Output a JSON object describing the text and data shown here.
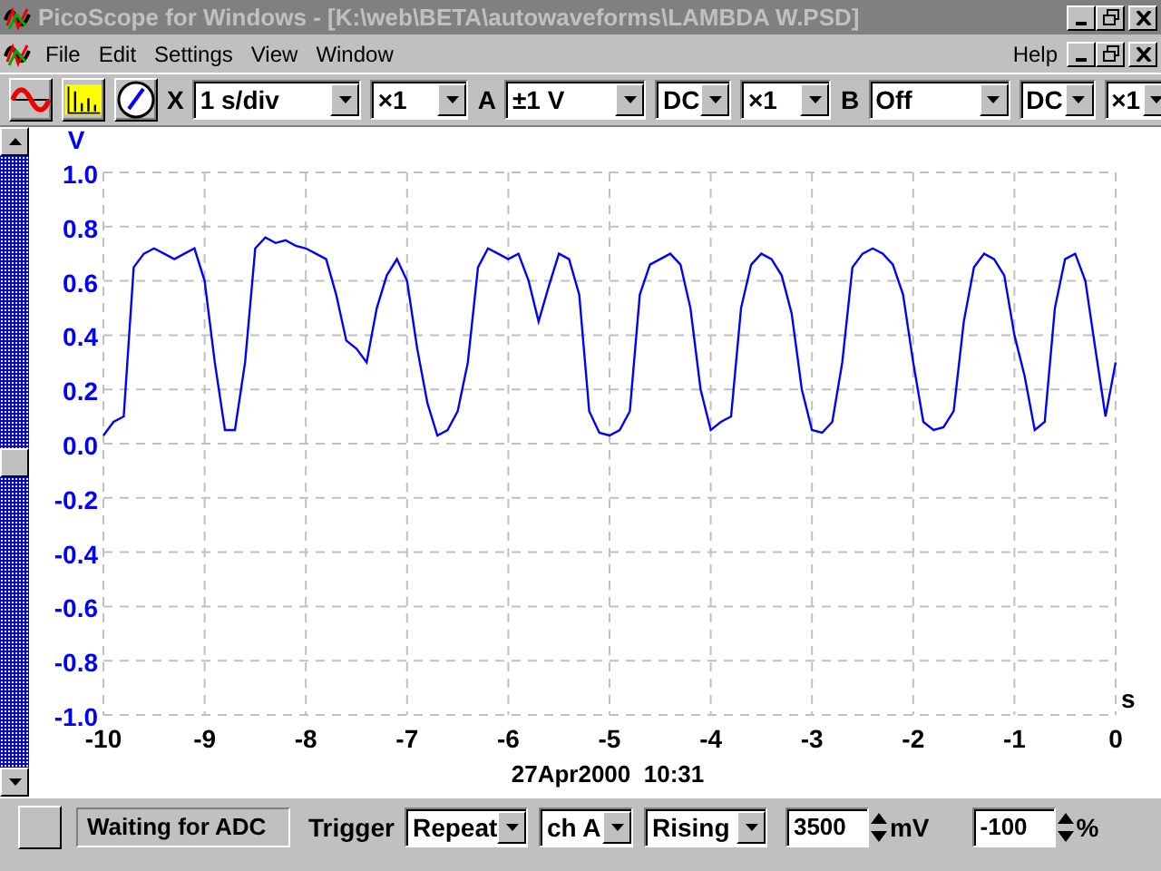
{
  "window": {
    "title": "PicoScope for Windows - [K:\\web\\BETA\\autowaveforms\\LAMBDA W.PSD]"
  },
  "menu": {
    "items": [
      "File",
      "Edit",
      "Settings",
      "View",
      "Window"
    ],
    "help": "Help"
  },
  "toolbar": [
    {
      "kind": "label",
      "text": "X"
    },
    {
      "kind": "dropdown",
      "value": "1 s/div"
    },
    {
      "kind": "dropdown",
      "value": "×1"
    },
    {
      "kind": "label",
      "text": "A"
    },
    {
      "kind": "dropdown",
      "value": "±1 V"
    },
    {
      "kind": "dropdown",
      "value": "DC"
    },
    {
      "kind": "dropdown",
      "value": "×1"
    },
    {
      "kind": "label",
      "text": "B"
    },
    {
      "kind": "dropdown",
      "value": "Off"
    },
    {
      "kind": "dropdown",
      "value": "DC"
    },
    {
      "kind": "dropdown",
      "value": "×1"
    }
  ],
  "plot": {
    "y_unit": "V",
    "x_unit": "s",
    "timestamp": "27Apr2000  10:31",
    "chart_data": {
      "type": "line",
      "grid": true,
      "xlim": [
        -10,
        0
      ],
      "ylim": [
        -1,
        1
      ],
      "xticks": [
        -10,
        -9,
        -8,
        -7,
        -6,
        -5,
        -4,
        -3,
        -2,
        -1,
        0
      ],
      "yticks": [
        {
          "value": 1,
          "label": "1.0"
        },
        {
          "value": 0.8,
          "label": "0.8"
        },
        {
          "value": 0.6,
          "label": "0.6"
        },
        {
          "value": 0.4,
          "label": "0.4"
        },
        {
          "value": 0.2,
          "label": "0.2"
        },
        {
          "value": 0,
          "label": "0.0"
        },
        {
          "value": -0.2,
          "label": "-0.2"
        },
        {
          "value": -0.4,
          "label": "-0.4"
        },
        {
          "value": -0.6,
          "label": "-0.6"
        },
        {
          "value": -0.8,
          "label": "-0.8"
        },
        {
          "value": -1,
          "label": "-1.0"
        }
      ],
      "x": [
        -10,
        -9.9,
        -9.8,
        -9.7,
        -9.6,
        -9.5,
        -9.4,
        -9.3,
        -9.2,
        -9.1,
        -9,
        -8.9,
        -8.8,
        -8.7,
        -8.6,
        -8.5,
        -8.4,
        -8.3,
        -8.2,
        -8.1,
        -8,
        -7.9,
        -7.8,
        -7.7,
        -7.6,
        -7.5,
        -7.4,
        -7.3,
        -7.2,
        -7.1,
        -7,
        -6.9,
        -6.8,
        -6.7,
        -6.6,
        -6.5,
        -6.4,
        -6.3,
        -6.2,
        -6.1,
        -6,
        -5.9,
        -5.8,
        -5.7,
        -5.6,
        -5.5,
        -5.4,
        -5.3,
        -5.2,
        -5.1,
        -5,
        -4.9,
        -4.8,
        -4.7,
        -4.6,
        -4.5,
        -4.4,
        -4.3,
        -4.2,
        -4.1,
        -4,
        -3.9,
        -3.8,
        -3.7,
        -3.6,
        -3.5,
        -3.4,
        -3.3,
        -3.2,
        -3.1,
        -3,
        -2.9,
        -2.8,
        -2.7,
        -2.6,
        -2.5,
        -2.4,
        -2.3,
        -2.2,
        -2.1,
        -2,
        -1.9,
        -1.8,
        -1.7,
        -1.6,
        -1.5,
        -1.4,
        -1.3,
        -1.2,
        -1.1,
        -1,
        -0.9,
        -0.8,
        -0.7,
        -0.6,
        -0.5,
        -0.4,
        -0.3,
        -0.2,
        -0.1,
        0
      ],
      "series": [
        {
          "color": "#0000ff",
          "values": [
            0.03,
            0.08,
            0.1,
            0.65,
            0.7,
            0.72,
            0.7,
            0.68,
            0.7,
            0.72,
            0.6,
            0.3,
            0.05,
            0.05,
            0.3,
            0.72,
            0.76,
            0.74,
            0.75,
            0.73,
            0.72,
            0.7,
            0.68,
            0.55,
            0.38,
            0.35,
            0.3,
            0.5,
            0.62,
            0.68,
            0.6,
            0.35,
            0.15,
            0.03,
            0.05,
            0.12,
            0.3,
            0.65,
            0.72,
            0.7,
            0.68,
            0.7,
            0.6,
            0.45,
            0.58,
            0.7,
            0.68,
            0.55,
            0.12,
            0.04,
            0.03,
            0.05,
            0.12,
            0.55,
            0.66,
            0.68,
            0.7,
            0.66,
            0.5,
            0.2,
            0.05,
            0.08,
            0.1,
            0.5,
            0.66,
            0.7,
            0.68,
            0.62,
            0.48,
            0.2,
            0.05,
            0.04,
            0.08,
            0.3,
            0.65,
            0.7,
            0.72,
            0.7,
            0.66,
            0.55,
            0.3,
            0.08,
            0.05,
            0.06,
            0.12,
            0.45,
            0.65,
            0.7,
            0.68,
            0.62,
            0.4,
            0.25,
            0.05,
            0.08,
            0.5,
            0.68,
            0.7,
            0.6,
            0.35,
            0.1,
            0.3
          ]
        }
      ]
    }
  },
  "status_bar": {
    "status": "Waiting for ADC",
    "trigger_label": "Trigger",
    "trigger_mode": "Repeat",
    "channel": "ch A",
    "edge": "Rising",
    "threshold": "3500",
    "threshold_unit": "mV",
    "delay": "-100",
    "delay_unit": "%"
  }
}
